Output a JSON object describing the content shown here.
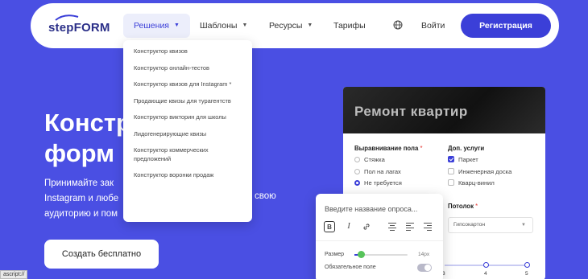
{
  "header": {
    "logo": "stepFORM",
    "nav": [
      {
        "label": "Решения"
      },
      {
        "label": "Шаблоны"
      },
      {
        "label": "Ресурсы"
      },
      {
        "label": "Тарифы"
      }
    ],
    "login": "Войти",
    "register": "Регистрация"
  },
  "dropdown": {
    "items": [
      "Конструктор квизов",
      "Конструктор онлайн-тестов",
      "Конструктор квизов для Instagram *",
      "Продающие квизы для турагентств",
      "Конструктор викторин для школы",
      "Лидогенерирующие квизы",
      "Конструктор коммерческих предложений",
      "Конструктор воронки продаж"
    ]
  },
  "hero": {
    "title_line1": "Констр",
    "title_line2": "форм",
    "subtitle_line1": "Принимайте зак",
    "subtitle_line2": "Instagram и любе",
    "subtitle_line2_tail": "свою",
    "subtitle_line3": "аудиторию и пом",
    "cta": "Создать бесплатно"
  },
  "status_tip": "ascript://",
  "quiz_card": {
    "banner_title": "Ремонт квартир",
    "q1": {
      "title": "Выравнивание пола",
      "options": [
        "Стяжка",
        "Пол на лагах",
        "Не требуется"
      ],
      "selected": 2
    },
    "q2": {
      "title": "Доп. услуги",
      "options": [
        "Паркет",
        "Инженерная доска",
        "Кварц-винил"
      ],
      "checked": [
        0
      ]
    },
    "q3": {
      "title": "Потолок",
      "select_value": "Гипсокартон"
    },
    "steps": [
      "3",
      "4",
      "5"
    ]
  },
  "editor": {
    "placeholder": "Введите название опроса...",
    "size_label": "Размер",
    "size_value": "14px",
    "required_label": "Обязательное поле",
    "size_fraction": 0.12
  },
  "colors": {
    "background": "#4a4fe3",
    "accent": "#3b3fd8",
    "slider_knob": "#57c35a",
    "required_star": "#e53935"
  }
}
